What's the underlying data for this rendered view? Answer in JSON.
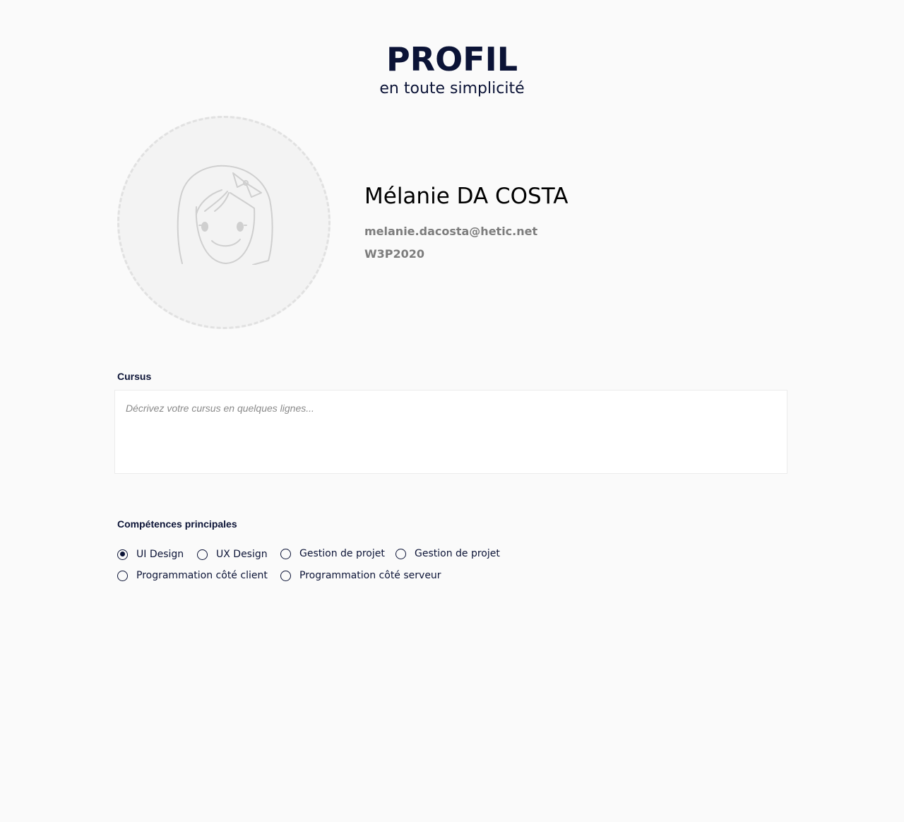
{
  "header": {
    "title": "PROFIL",
    "subtitle": "en toute simplicité"
  },
  "profile": {
    "avatar_icon": "girl-avatar-icon",
    "name": "Mélanie DA COSTA",
    "email": "melanie.dacosta@hetic.net",
    "promo": "W3P2020"
  },
  "cursus": {
    "label": "Cursus",
    "placeholder": "Décrivez votre cursus en quelques lignes...",
    "value": ""
  },
  "skills": {
    "label": "Compétences principales",
    "options": [
      {
        "label": "UI Design",
        "checked": true
      },
      {
        "label": "UX Design",
        "checked": false
      },
      {
        "label": "Gestion de projet",
        "checked": false
      },
      {
        "label": "Gestion de projet",
        "checked": false
      },
      {
        "label": "Programmation côté client",
        "checked": false
      },
      {
        "label": "Programmation côté serveur",
        "checked": false
      }
    ]
  },
  "colors": {
    "primary": "#0b1336",
    "muted_text": "#7d7d7d",
    "background": "#fafafa",
    "avatar_bg": "#f3f3f3"
  }
}
